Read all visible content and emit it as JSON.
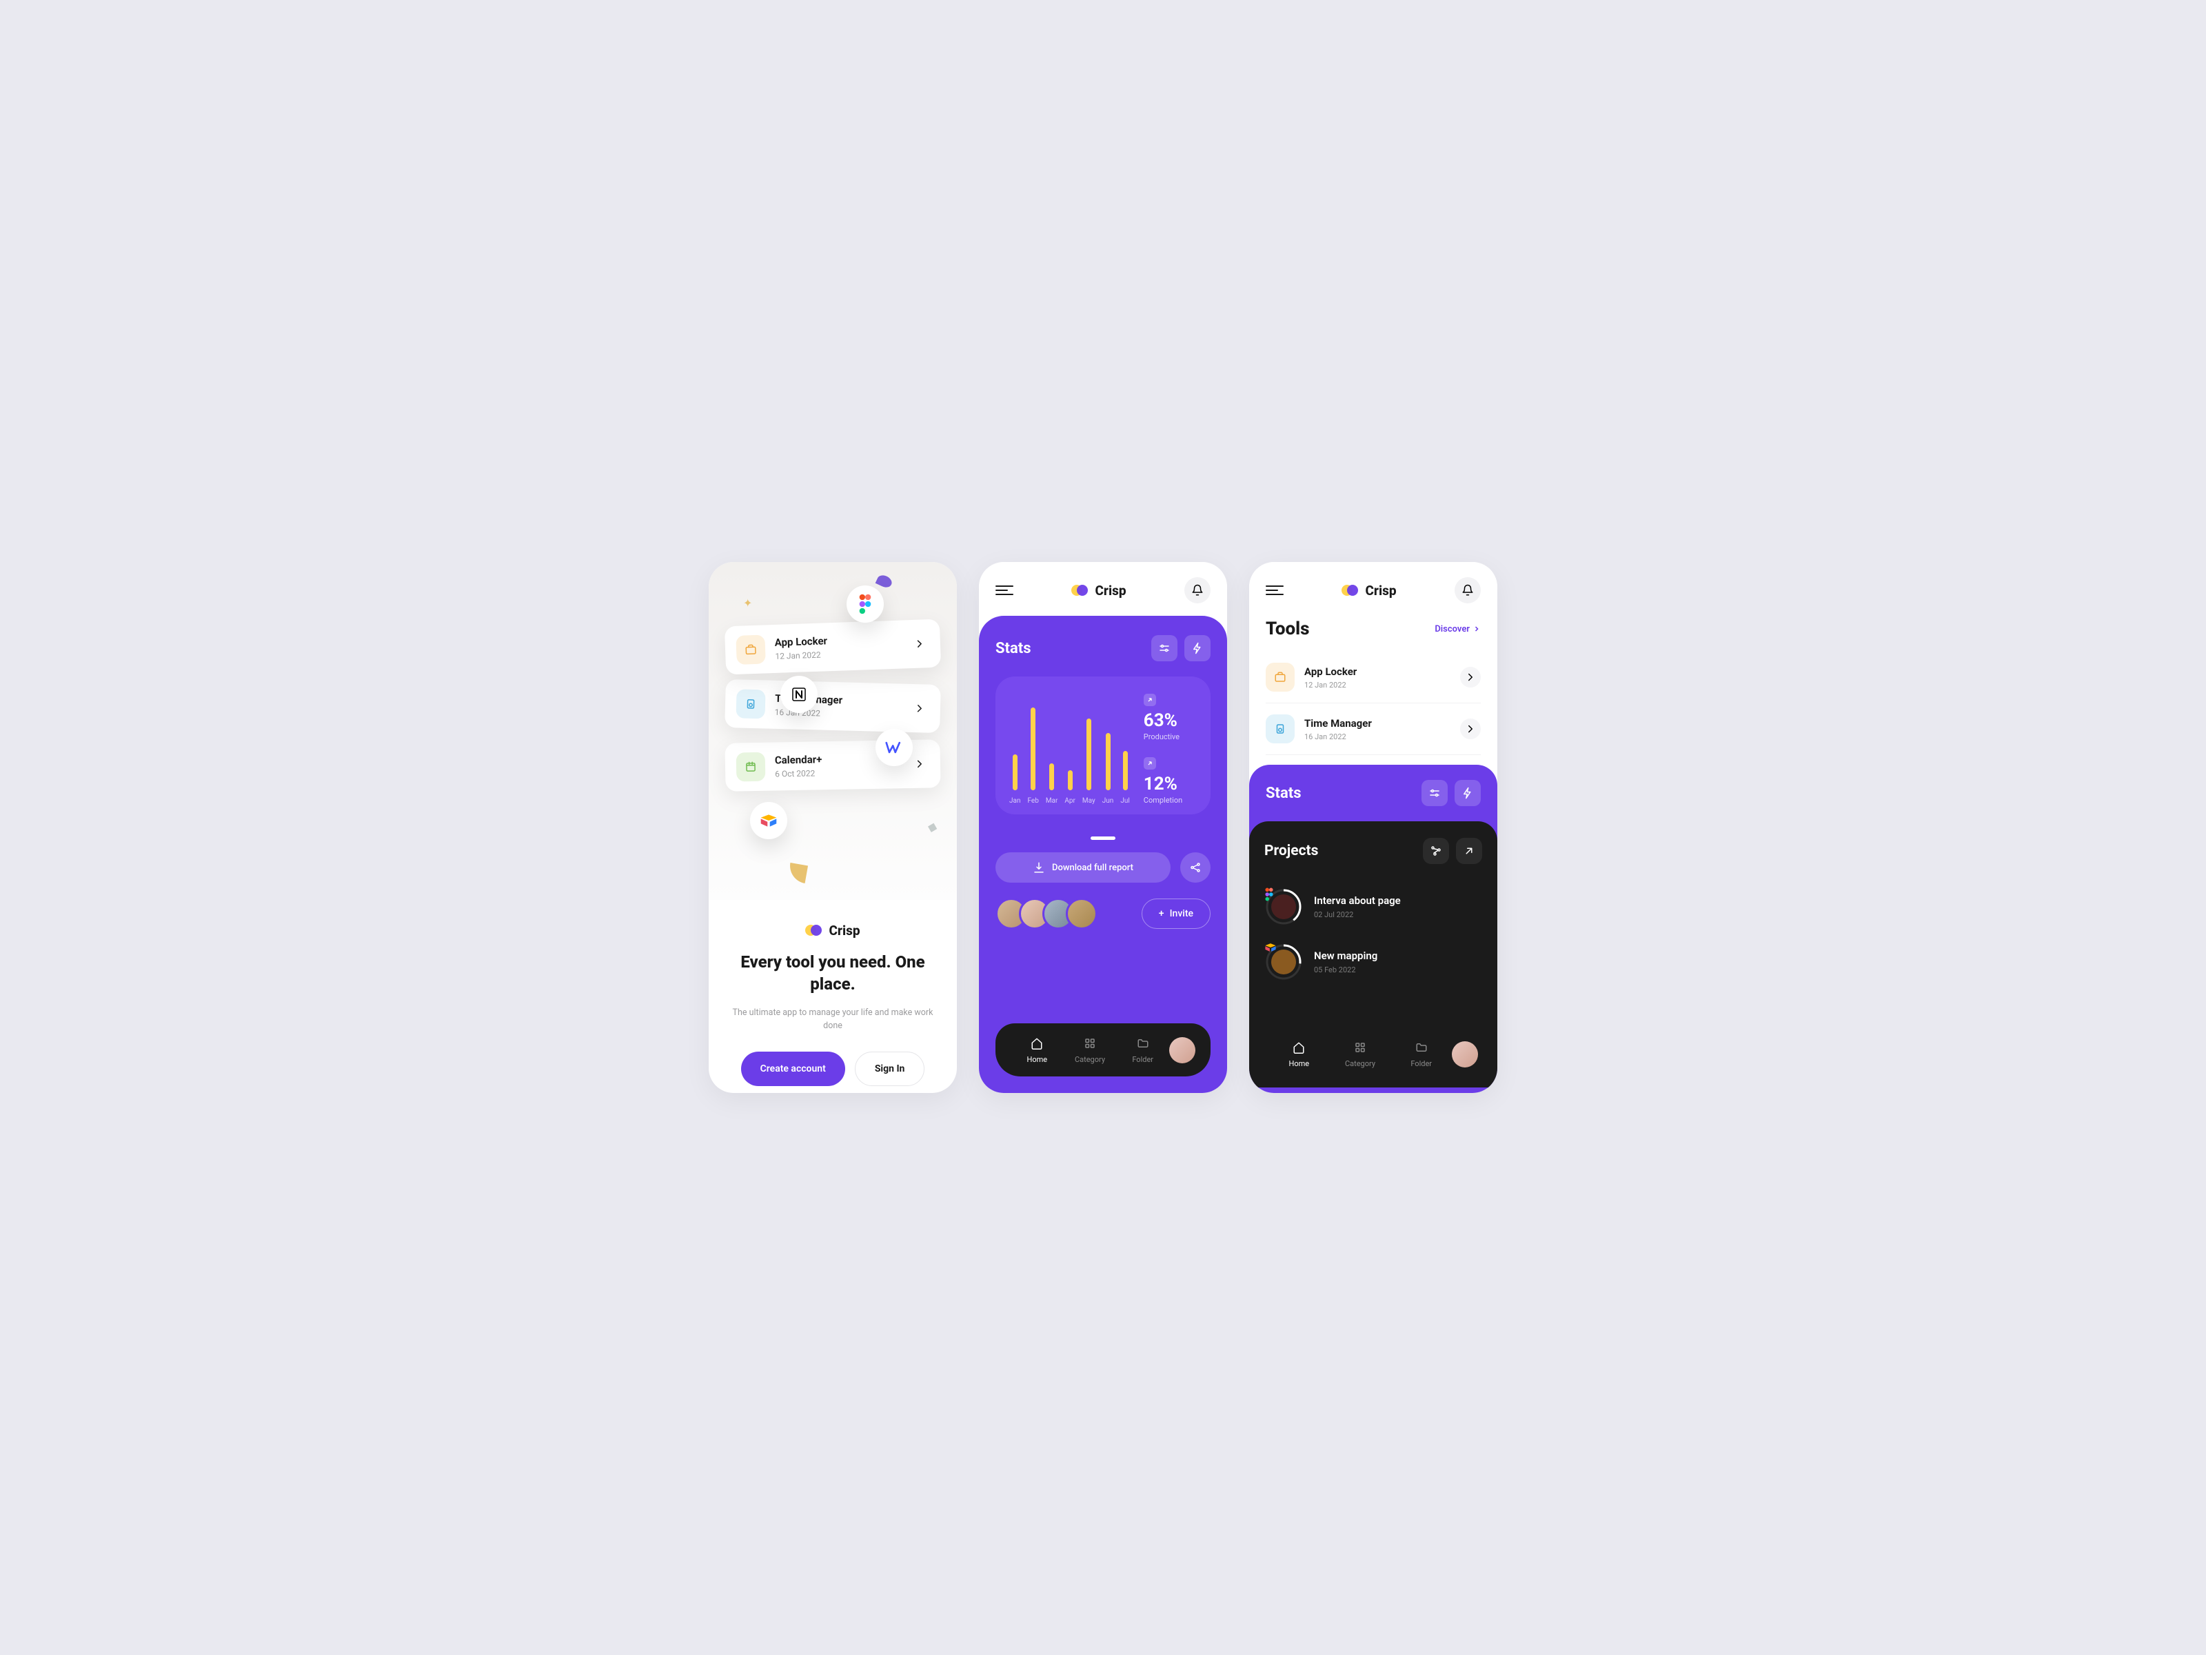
{
  "brand": "Crisp",
  "screen1": {
    "cards": [
      {
        "title": "App Locker",
        "date": "12 Jan 2022"
      },
      {
        "title": "Time Manager",
        "date": "16 Jan 2022"
      },
      {
        "title": "Calendar+",
        "date": "6 Oct 2022"
      }
    ],
    "headline": "Every tool you need. One place.",
    "subtitle": "The ultimate app to manage your life and make work done",
    "cta_primary": "Create account",
    "cta_secondary": "Sign In"
  },
  "screen2": {
    "stats_title": "Stats",
    "kpis": [
      {
        "value": "63%",
        "label": "Productive"
      },
      {
        "value": "12%",
        "label": "Completion"
      }
    ],
    "download_label": "Download full report",
    "invite_label": "Invite",
    "nav": [
      {
        "label": "Home",
        "active": true
      },
      {
        "label": "Category",
        "active": false
      },
      {
        "label": "Folder",
        "active": false
      }
    ]
  },
  "chart_data": {
    "type": "bar",
    "categories": [
      "Jan",
      "Feb",
      "Mar",
      "Apr",
      "May",
      "Jun",
      "Jul"
    ],
    "values": [
      40,
      92,
      30,
      22,
      80,
      64,
      44
    ],
    "title": "Stats",
    "xlabel": "",
    "ylabel": "",
    "ylim": [
      0,
      100
    ]
  },
  "screen3": {
    "tools_title": "Tools",
    "discover_label": "Discover",
    "tools": [
      {
        "title": "App Locker",
        "date": "12 Jan 2022"
      },
      {
        "title": "Time Manager",
        "date": "16 Jan 2022"
      }
    ],
    "stats_title": "Stats",
    "projects_title": "Projects",
    "projects": [
      {
        "title": "Interva about page",
        "date": "02 Jul 2022"
      },
      {
        "title": "New mapping",
        "date": "05 Feb 2022"
      }
    ],
    "nav": [
      {
        "label": "Home",
        "active": true
      },
      {
        "label": "Category",
        "active": false
      },
      {
        "label": "Folder",
        "active": false
      }
    ]
  },
  "colors": {
    "purple": "#6b3de8",
    "yellow": "#ffd14a",
    "dark": "#1b1b1b"
  }
}
